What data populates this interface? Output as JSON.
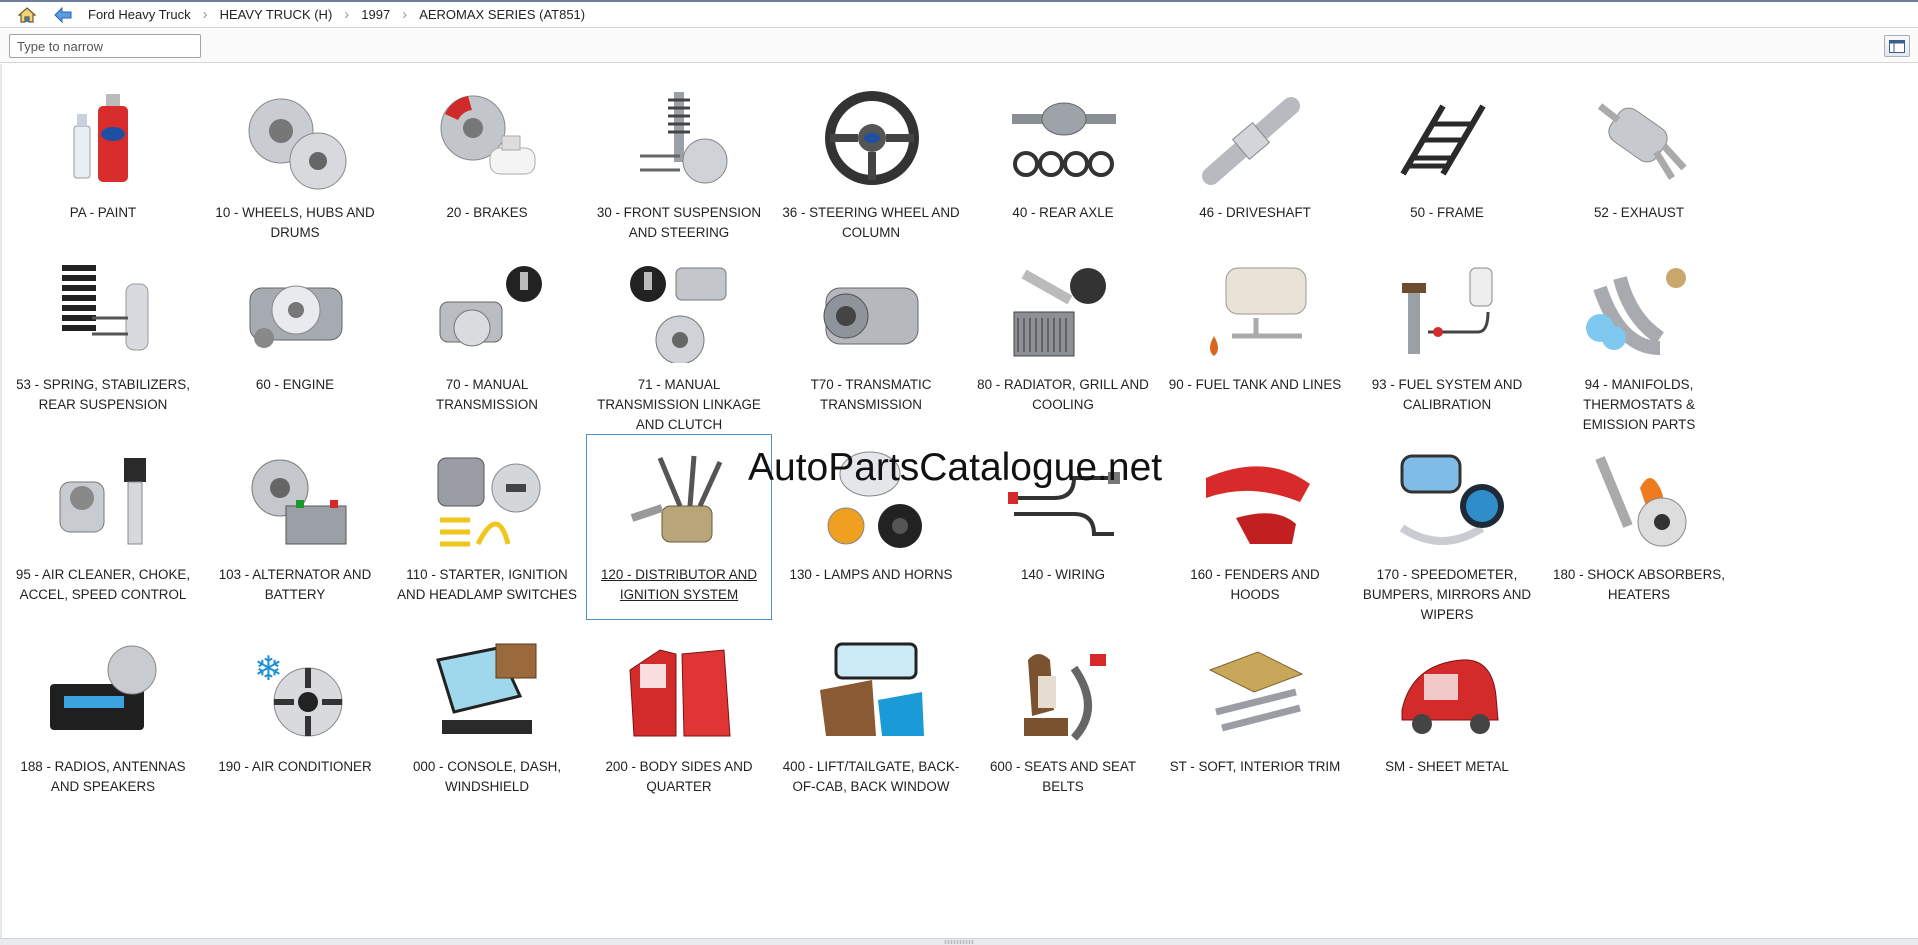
{
  "breadcrumb": [
    "Ford Heavy Truck",
    "HEAVY TRUCK (H)",
    "1997",
    "AEROMAX SERIES (AT851)"
  ],
  "toolbar": {
    "home_icon": "home-icon",
    "back_icon": "back-arrow-icon"
  },
  "search": {
    "placeholder": "Type to narrow",
    "value": ""
  },
  "view_toggle_icon": "panel-layout-icon",
  "watermark": "AutoPartsCatalogue.net",
  "selected_category": "120 - DISTRIBUTOR AND IGNITION SYSTEM",
  "categories": [
    {
      "label": "PA - PAINT",
      "icon": "paint-can-icon"
    },
    {
      "label": "10 - WHEELS, HUBS AND DRUMS",
      "icon": "wheel-icon"
    },
    {
      "label": "20 - BRAKES",
      "icon": "brake-icon"
    },
    {
      "label": "30 - FRONT SUSPENSION AND STEERING",
      "icon": "suspension-icon"
    },
    {
      "label": "36 - STEERING WHEEL AND COLUMN",
      "icon": "steering-wheel-icon"
    },
    {
      "label": "40 - REAR AXLE",
      "icon": "axle-icon"
    },
    {
      "label": "46 - DRIVESHAFT",
      "icon": "driveshaft-icon"
    },
    {
      "label": "50 - FRAME",
      "icon": "frame-icon"
    },
    {
      "label": "52 - EXHAUST",
      "icon": "exhaust-icon"
    },
    {
      "label": "53 - SPRING, STABILIZERS, REAR SUSPENSION",
      "icon": "spring-icon"
    },
    {
      "label": "60 - ENGINE",
      "icon": "engine-icon"
    },
    {
      "label": "70 - MANUAL TRANSMISSION",
      "icon": "transmission-icon"
    },
    {
      "label": "71 - MANUAL TRANSMISSION LINKAGE AND CLUTCH",
      "icon": "clutch-icon"
    },
    {
      "label": "T70 - TRANSMATIC TRANSMISSION",
      "icon": "auto-transmission-icon"
    },
    {
      "label": "80 - RADIATOR, GRILL AND COOLING",
      "icon": "radiator-icon"
    },
    {
      "label": "90 - FUEL TANK AND LINES",
      "icon": "fuel-tank-icon"
    },
    {
      "label": "93 - FUEL SYSTEM AND CALIBRATION",
      "icon": "fuel-system-icon"
    },
    {
      "label": "94 - MANIFOLDS, THERMOSTATS & EMISSION PARTS",
      "icon": "manifold-icon"
    },
    {
      "label": "95 - AIR CLEANER, CHOKE, ACCEL, SPEED CONTROL",
      "icon": "carburetor-icon"
    },
    {
      "label": "103 - ALTERNATOR AND BATTERY",
      "icon": "battery-icon"
    },
    {
      "label": "110 - STARTER, IGNITION AND HEADLAMP SWITCHES",
      "icon": "starter-icon"
    },
    {
      "label": "120 - DISTRIBUTOR AND IGNITION SYSTEM",
      "icon": "distributor-icon"
    },
    {
      "label": "130 - LAMPS AND HORNS",
      "icon": "lamp-icon"
    },
    {
      "label": "140 - WIRING",
      "icon": "wiring-icon"
    },
    {
      "label": "160 - FENDERS AND HOODS",
      "icon": "fender-icon"
    },
    {
      "label": "170 - SPEEDOMETER, BUMPERS, MIRRORS AND WIPERS",
      "icon": "mirror-icon"
    },
    {
      "label": "180 - SHOCK ABSORBERS, HEATERS",
      "icon": "shock-absorber-icon"
    },
    {
      "label": "188 - RADIOS, ANTENNAS AND SPEAKERS",
      "icon": "radio-icon"
    },
    {
      "label": "190 - AIR CONDITIONER",
      "icon": "air-conditioner-icon"
    },
    {
      "label": "000 - CONSOLE, DASH, WINDSHIELD",
      "icon": "windshield-icon"
    },
    {
      "label": "200 - BODY SIDES AND QUARTER",
      "icon": "door-icon"
    },
    {
      "label": "400 - LIFT/TAILGATE, BACK-OF-CAB, BACK WINDOW",
      "icon": "back-window-icon"
    },
    {
      "label": "600 - SEATS AND SEAT BELTS",
      "icon": "seat-icon"
    },
    {
      "label": "ST - SOFT, INTERIOR TRIM",
      "icon": "interior-trim-icon"
    },
    {
      "label": "SM - SHEET METAL",
      "icon": "sheet-metal-icon"
    }
  ]
}
